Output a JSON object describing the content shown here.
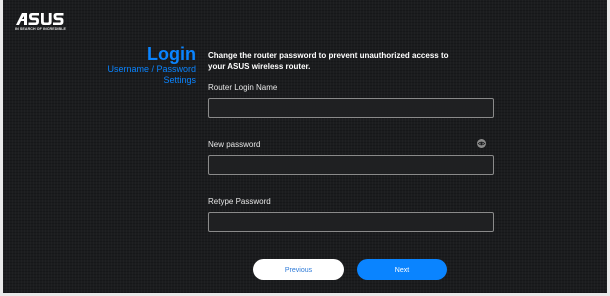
{
  "brand": {
    "logo_text": "ASUS",
    "tagline": "IN SEARCH OF INCREDIBLE"
  },
  "sidebar": {
    "title": "Login",
    "subtitle_line1": "Username / Password",
    "subtitle_line2": "Settings"
  },
  "form": {
    "headline_line1": "Change the router password to prevent unauthorized access to",
    "headline_line2": "your ASUS wireless router.",
    "login_name_label": "Router Login Name",
    "login_name_value": "",
    "new_password_label": "New password",
    "new_password_value": "",
    "retype_password_label": "Retype Password",
    "retype_password_value": ""
  },
  "actions": {
    "previous_label": "Previous",
    "next_label": "Next"
  },
  "colors": {
    "background": "#1b1c1e",
    "accent": "#0a84ff",
    "field_border": "#8a8a8a"
  },
  "icons": {
    "show_password": "eye-icon"
  }
}
